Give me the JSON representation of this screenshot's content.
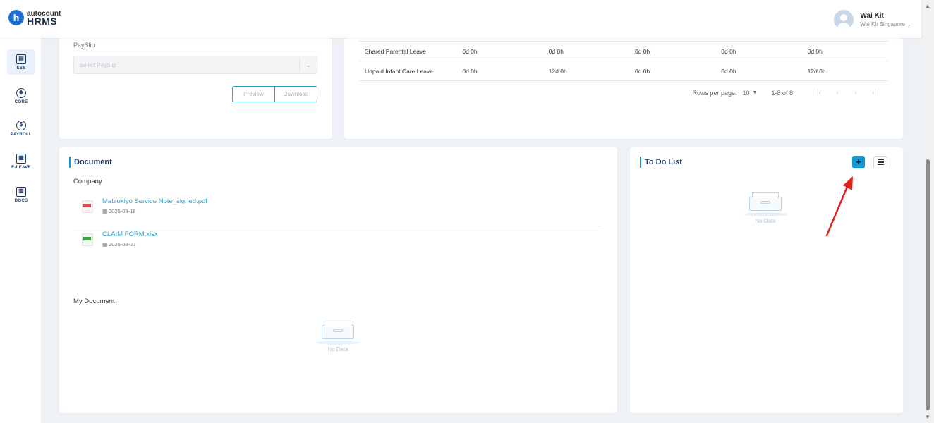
{
  "app": {
    "logo_top": "autocount",
    "logo_bottom": "HRMS",
    "logo_letter": "h"
  },
  "user": {
    "name": "Wai Kit",
    "company": "Wai Kit Singapore ⌄"
  },
  "sidenav": [
    {
      "label": "ESS",
      "icon": "ess-icon",
      "active": true
    },
    {
      "label": "CORE",
      "icon": "core-icon"
    },
    {
      "label": "PAYROLL",
      "icon": "payroll-icon"
    },
    {
      "label": "E-LEAVE",
      "icon": "calendar-icon"
    },
    {
      "label": "DOCS",
      "icon": "docs-icon"
    }
  ],
  "payslip": {
    "label": "PaySlip",
    "select_placeholder": "Select PaySlip",
    "preview": "Preview",
    "download": "Download"
  },
  "leave_rows": [
    {
      "type": "Shared Parental Leave",
      "values": [
        "0d 0h",
        "0d 0h",
        "0d 0h",
        "0d 0h",
        "0d 0h"
      ]
    },
    {
      "type": "Unpaid Infant Care Leave",
      "values": [
        "0d 0h",
        "12d 0h",
        "0d 0h",
        "0d 0h",
        "12d 0h"
      ]
    }
  ],
  "pager": {
    "rows_per_page_label": "Rows per page:",
    "rows_per_page": "10",
    "range": "1-8 of 8"
  },
  "document": {
    "title": "Document",
    "company_label": "Company",
    "files": [
      {
        "name": "Matsukiyo Service Note_signed.pdf",
        "date": "2025-09-18",
        "kind": "pdf"
      },
      {
        "name": "CLAIM FORM.xlsx",
        "date": "2025-08-27",
        "kind": "xlsx"
      }
    ],
    "my_document_label": "My Document",
    "no_data": "No Data"
  },
  "todo": {
    "title": "To Do List",
    "add": "+",
    "no_data": "No Data"
  },
  "colors": {
    "accent": "#2aa6cf",
    "brand": "#1f6fd1",
    "add_button": "#0f9ad7",
    "arrow": "#e0201b"
  }
}
